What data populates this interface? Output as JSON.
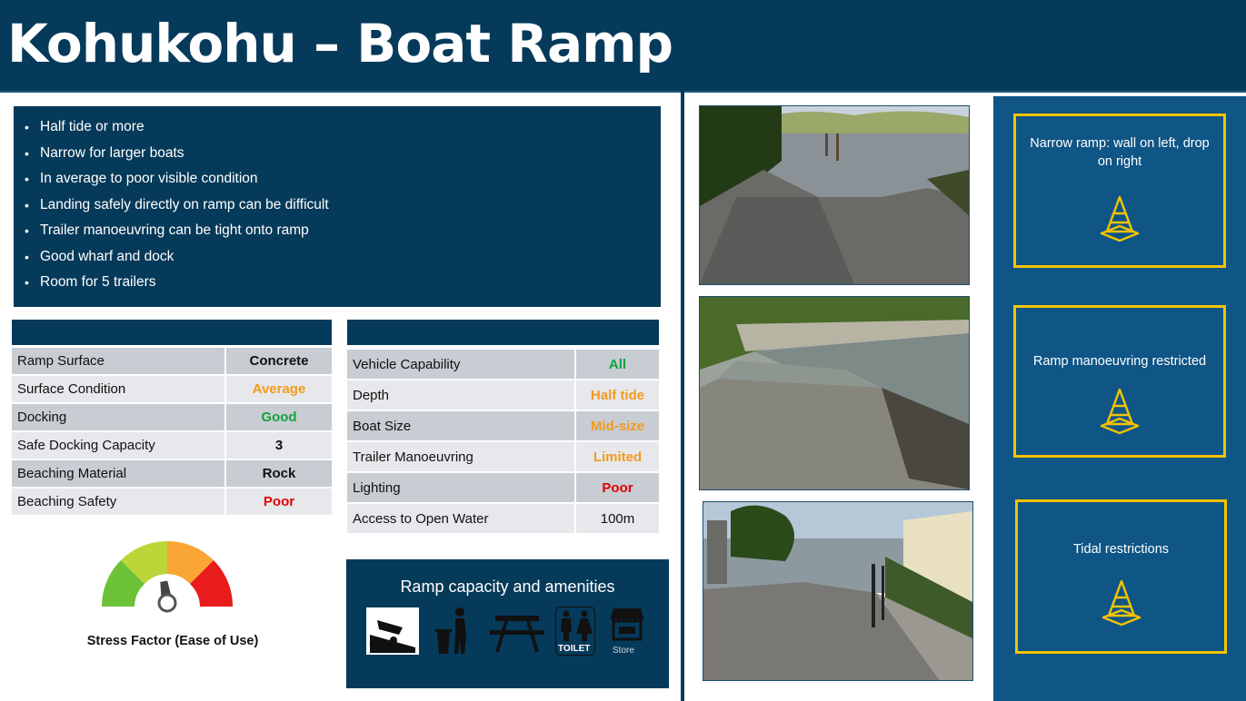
{
  "title": "Kohukohu – Boat Ramp",
  "bullets": [
    "Half tide or more",
    "Narrow for larger boats",
    "In average to poor visible condition",
    "Landing safely directly on ramp can be difficult",
    "Trailer manoeuvring can be tight onto ramp",
    "Good wharf and dock",
    "Room for 5 trailers"
  ],
  "table_left": [
    {
      "label": "Ramp Surface",
      "value": "Concrete",
      "color": "#111111"
    },
    {
      "label": "Surface Condition",
      "value": "Average",
      "color": "#f39a1d"
    },
    {
      "label": "Docking",
      "value": "Good",
      "color": "#14a33c"
    },
    {
      "label": "Safe Docking Capacity",
      "value": "3",
      "color": "#111111"
    },
    {
      "label": "Beaching Material",
      "value": "Rock",
      "color": "#111111"
    },
    {
      "label": "Beaching Safety",
      "value": "Poor",
      "color": "#e00000"
    }
  ],
  "table_right": [
    {
      "label": "Vehicle Capability",
      "value": "All",
      "color": "#14a33c"
    },
    {
      "label": "Depth",
      "value": "Half tide",
      "color": "#f39a1d"
    },
    {
      "label": "Boat Size",
      "value": "Mid-size",
      "color": "#f39a1d"
    },
    {
      "label": "Trailer Manoeuvring",
      "value": "Limited",
      "color": "#f39a1d"
    },
    {
      "label": "Lighting",
      "value": "Poor",
      "color": "#e00000"
    },
    {
      "label": "Access to Open Water",
      "value": "100m",
      "color": "#111111"
    }
  ],
  "gauge": {
    "label": "Stress Factor (Ease of Use)",
    "level": 0.45
  },
  "amenities": {
    "title": "Ramp capacity and amenities",
    "icons": [
      "boat-ramp-icon",
      "rubbish-bin-icon",
      "picnic-table-icon",
      "toilet-icon",
      "store-icon"
    ],
    "toilet_label": "TOILET",
    "store_label": "Store"
  },
  "warnings": [
    {
      "text": "Narrow ramp: wall on left, drop on right",
      "icon": "traffic-cone-icon"
    },
    {
      "text": "Ramp manoeuvring restricted",
      "icon": "traffic-cone-icon"
    },
    {
      "text": "Tidal restrictions",
      "icon": "traffic-cone-icon"
    }
  ],
  "colors": {
    "navy": "#063a5a",
    "panel_blue": "#0f5585",
    "warning_border": "#f3c300",
    "good": "#14a33c",
    "average": "#f39a1d",
    "poor": "#e00000"
  }
}
